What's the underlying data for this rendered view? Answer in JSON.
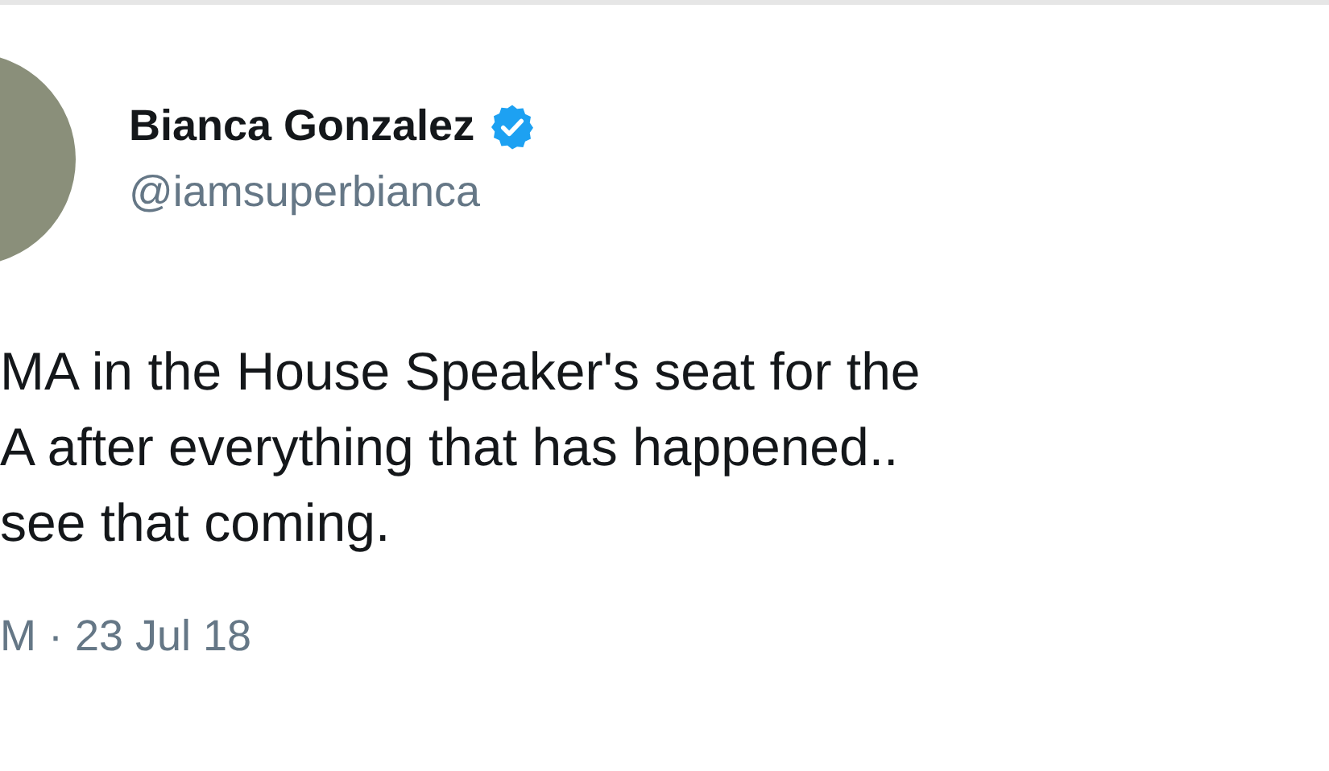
{
  "author": {
    "name": "Bianca Gonzalez",
    "verified": true,
    "handle": "@iamsuperbianca"
  },
  "tweet_lines": [
    "MA in the House Speaker's seat for the",
    "A after everything that has happened..",
    "see that coming."
  ],
  "timestamp": "M · 23 Jul 18"
}
